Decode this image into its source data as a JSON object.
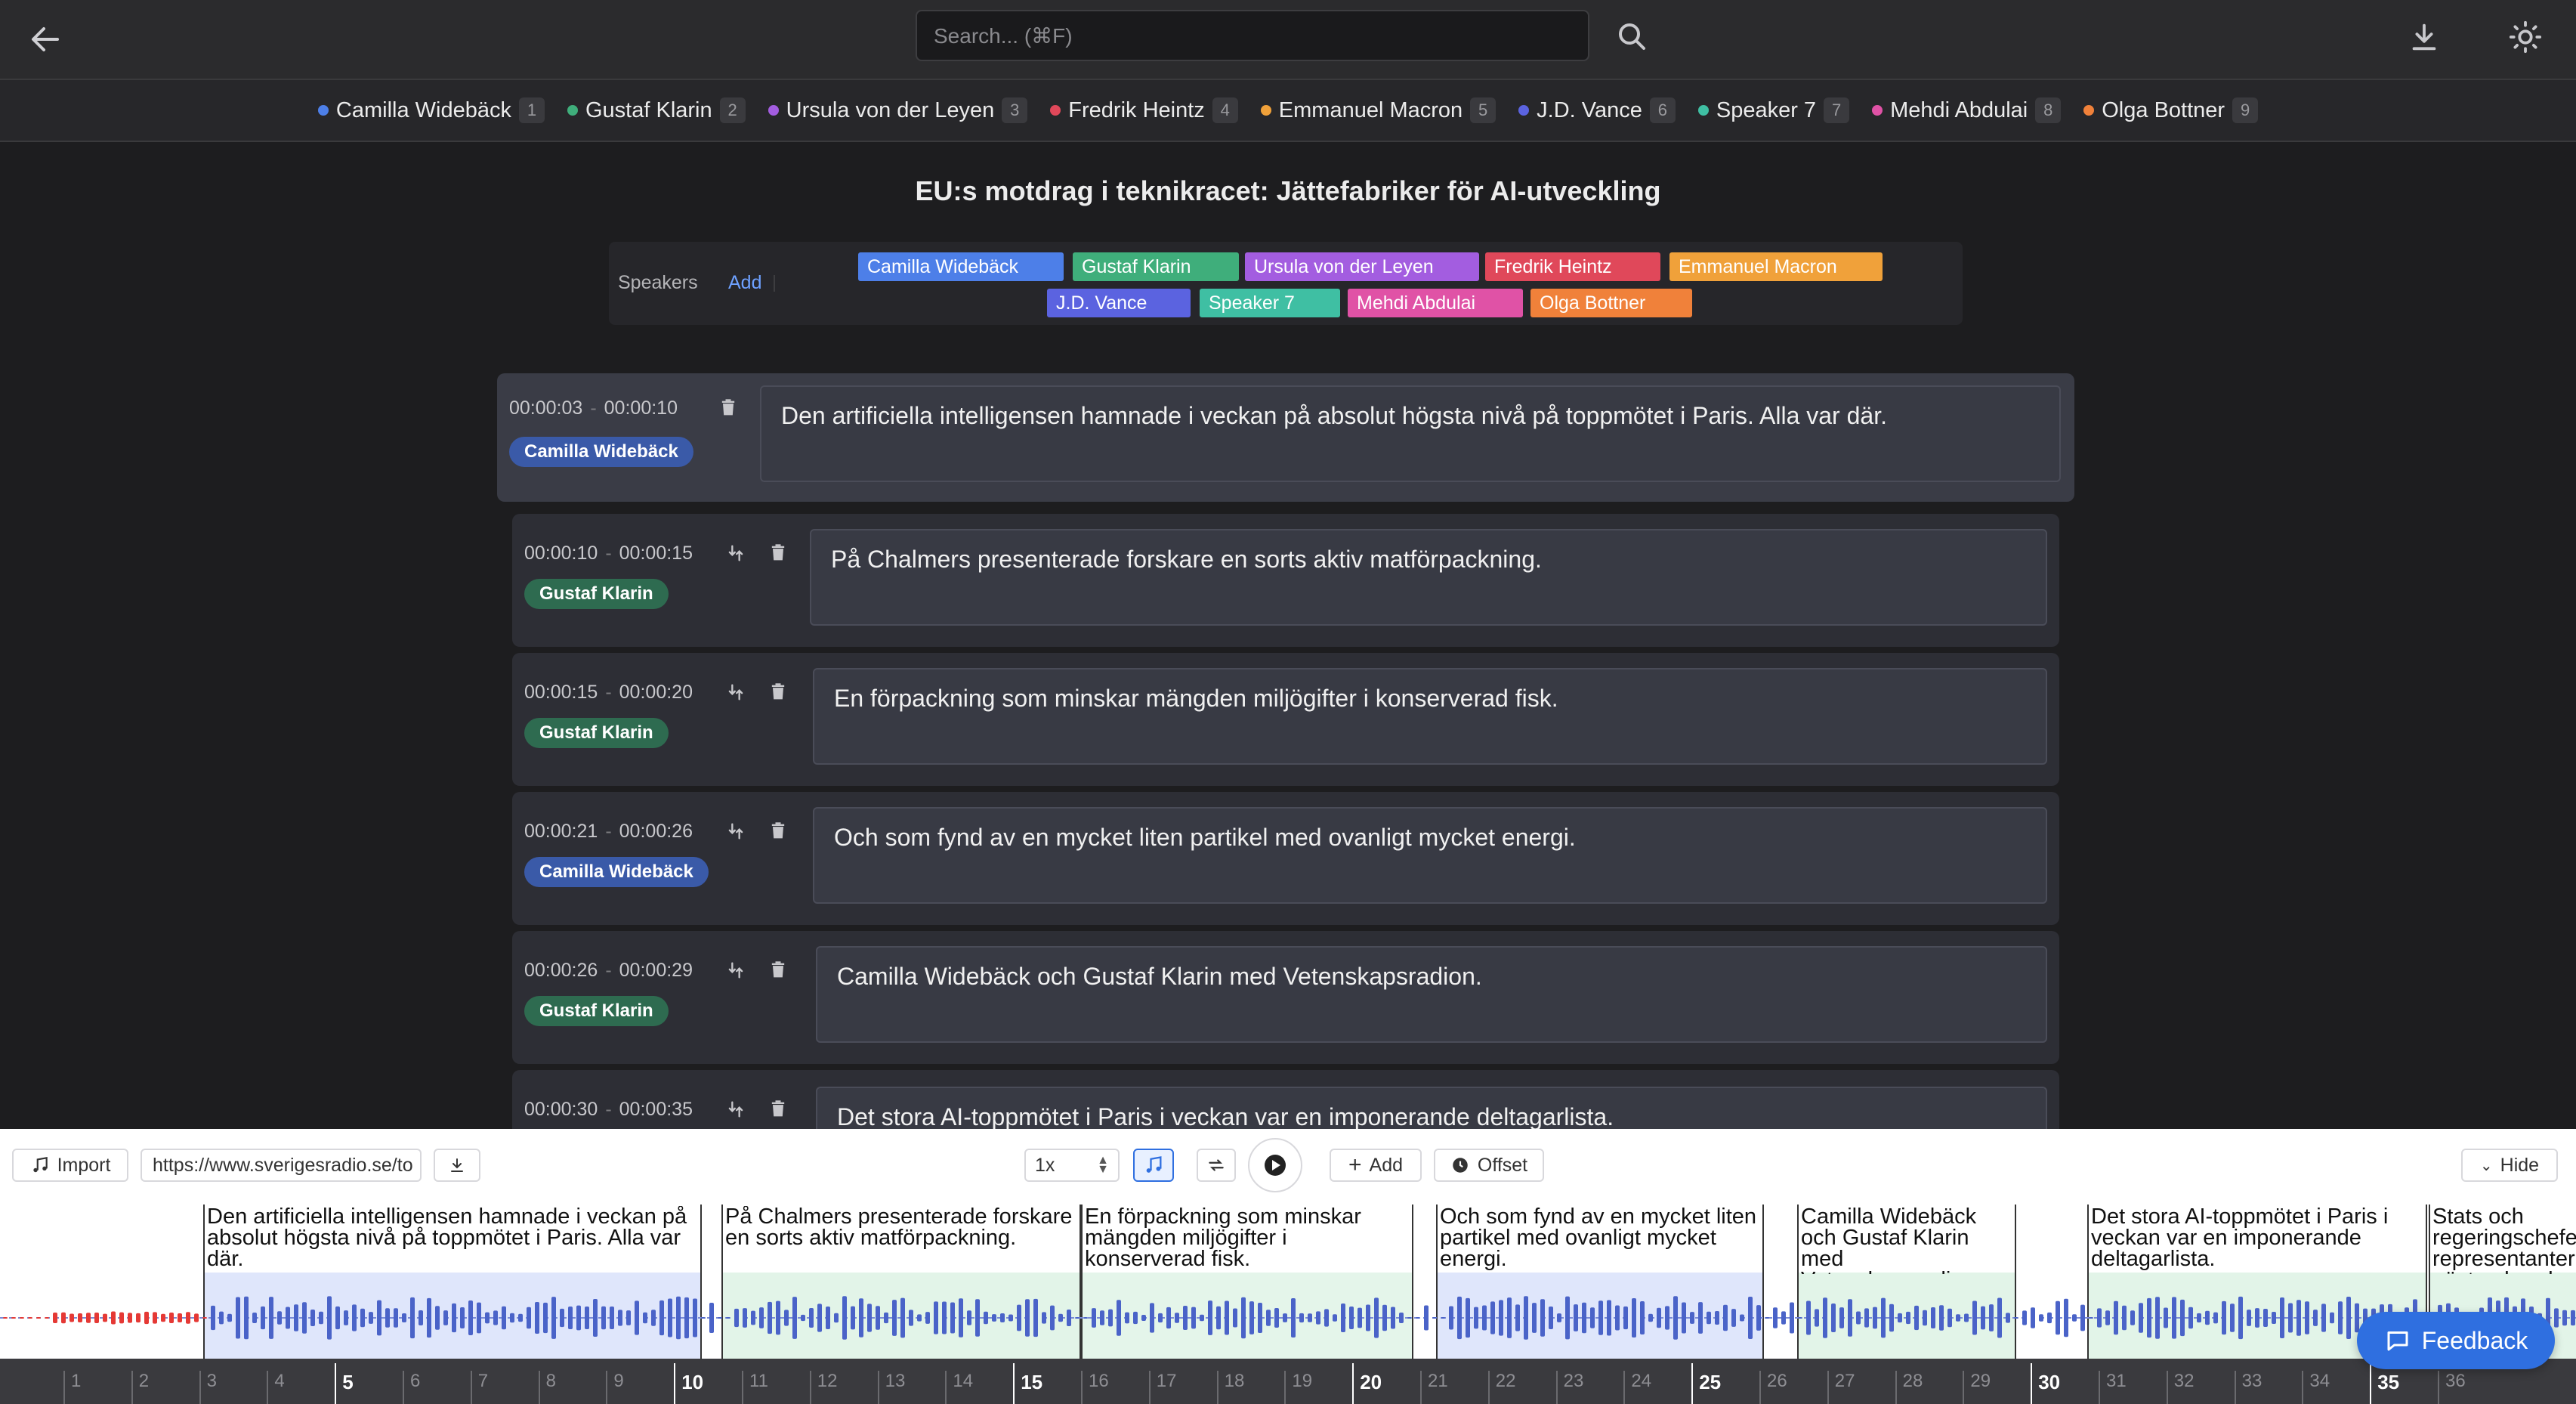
{
  "search": {
    "placeholder": "Search... (⌘F)"
  },
  "speaker_tabs": [
    {
      "name": "Camilla Widebäck",
      "num": "1",
      "color": "#4d7fe8"
    },
    {
      "name": "Gustaf Klarin",
      "num": "2",
      "color": "#3fae7b"
    },
    {
      "name": "Ursula von der Leyen",
      "num": "3",
      "color": "#a35de0"
    },
    {
      "name": "Fredrik Heintz",
      "num": "4",
      "color": "#e0485a"
    },
    {
      "name": "Emmanuel Macron",
      "num": "5",
      "color": "#f0a13a"
    },
    {
      "name": "J.D. Vance",
      "num": "6",
      "color": "#5b63e0"
    },
    {
      "name": "Speaker 7",
      "num": "7",
      "color": "#3fbfa3"
    },
    {
      "name": "Mehdi Abdulai",
      "num": "8",
      "color": "#e052a6"
    },
    {
      "name": "Olga Bottner",
      "num": "9",
      "color": "#f0813a"
    }
  ],
  "title": "EU:s motdrag i teknikracet: Jättefabriker för AI-utveckling",
  "speakers_panel": {
    "label": "Speakers",
    "add": "Add",
    "chips": [
      {
        "name": "Camilla Widebäck",
        "color": "#4d7fe8"
      },
      {
        "name": "Gustaf Klarin",
        "color": "#3fae7b"
      },
      {
        "name": "Ursula von der Leyen",
        "color": "#a35de0"
      },
      {
        "name": "Fredrik Heintz",
        "color": "#e0485a"
      },
      {
        "name": "Emmanuel Macron",
        "color": "#f0a13a"
      },
      {
        "name": "J.D. Vance",
        "color": "#5b63e0"
      },
      {
        "name": "Speaker 7",
        "color": "#3fbfa3"
      },
      {
        "name": "Mehdi Abdulai",
        "color": "#e052a6"
      },
      {
        "name": "Olga Bottner",
        "color": "#f0813a"
      }
    ]
  },
  "segments": [
    {
      "start": "00:00:03",
      "end": "00:00:10",
      "speaker": "Camilla Widebäck",
      "badge_color": "#3a5aa8",
      "text": "Den artificiella intelligensen hamnade i veckan på absolut högsta nivå på toppmötet i Paris. Alla var där."
    },
    {
      "start": "00:00:10",
      "end": "00:00:15",
      "speaker": "Gustaf Klarin",
      "badge_color": "#2e6b50",
      "text": "På Chalmers presenterade forskare en sorts aktiv matförpackning."
    },
    {
      "start": "00:00:15",
      "end": "00:00:20",
      "speaker": "Gustaf Klarin",
      "badge_color": "#2e6b50",
      "text": "En förpackning som minskar mängden miljögifter i konserverad fisk."
    },
    {
      "start": "00:00:21",
      "end": "00:00:26",
      "speaker": "Camilla Widebäck",
      "badge_color": "#3a5aa8",
      "text": "Och som fynd av en mycket liten partikel med ovanligt mycket energi."
    },
    {
      "start": "00:00:26",
      "end": "00:00:29",
      "speaker": "Gustaf Klarin",
      "badge_color": "#2e6b50",
      "text": "Camilla Widebäck och Gustaf Klarin med Vetenskapsradion."
    },
    {
      "start": "00:00:30",
      "end": "00:00:35",
      "speaker": "",
      "badge_color": "#2e6b50",
      "text": "Det stora AI-toppmötet i Paris i veckan var en imponerande deltagarlista."
    }
  ],
  "player": {
    "import": "Import",
    "url": "https://www.sverigesradio.se/to",
    "speed": "1x",
    "add": "Add",
    "offset": "Offset",
    "hide": "Hide"
  },
  "timeline": {
    "labels": [
      "Den artificiella intelligensen hamnade i veckan på absolut högsta nivå på toppmötet i Paris. Alla var där.",
      "På Chalmers presenterade forskare en sorts aktiv matförpackning.",
      "En förpackning som minskar mängden miljögifter i konserverad fisk.",
      "Och som fynd av en mycket liten partikel med ovanligt mycket energi.",
      "Camilla Widebäck och Gustaf Klarin med Vetenskapsradion.",
      "Det stora AI-toppmötet i Paris i veckan var en imponerande deltagarlista.",
      "Stats och regeringschefer representanter nästan hundra"
    ],
    "ticks": [
      "1",
      "2",
      "3",
      "4",
      "5",
      "6",
      "7",
      "8",
      "9",
      "10",
      "11",
      "12",
      "13",
      "14",
      "15",
      "16",
      "17",
      "18",
      "19",
      "20",
      "21",
      "22",
      "23",
      "24",
      "25",
      "26",
      "27",
      "28",
      "29",
      "30",
      "31",
      "32",
      "33",
      "34",
      "35",
      "36"
    ]
  },
  "feedback": "Feedback"
}
